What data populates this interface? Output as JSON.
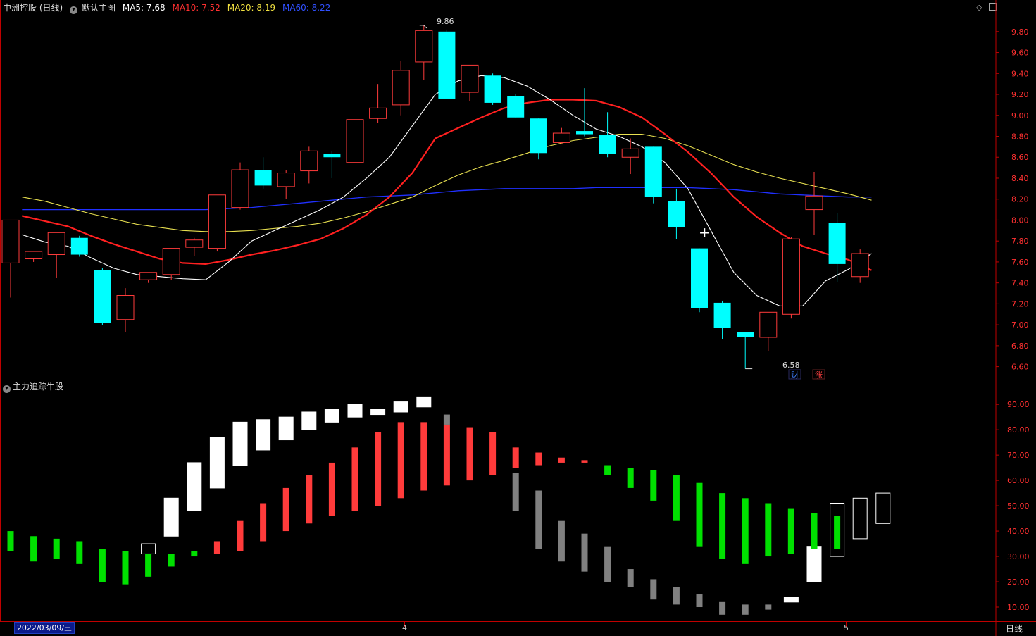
{
  "header": {
    "stock_label": "中洲控股 (日线)",
    "chart_label": "默认主图",
    "ma5": "MA5: 7.68",
    "ma10": "MA10: 7.52",
    "ma20": "MA20: 8.19",
    "ma60": "MA60: 8.22"
  },
  "sub_indicator": {
    "label": "主力追踪牛股"
  },
  "bottom_bar": {
    "date": "2022/03/09/三",
    "month_4": "4",
    "month_5": "5",
    "period": "日线"
  },
  "badges": {
    "cai": "财",
    "zhang": "涨"
  },
  "crosshair": "+",
  "colors": {
    "up": "#ff3b3b",
    "down": "#00ffff",
    "ma5": "#ffffff",
    "ma10": "#ff2020",
    "ma20": "#e8e050",
    "ma60": "#2030ff",
    "axis": "#c00000",
    "green": "#00e000",
    "gray": "#808080",
    "white": "#ffffff"
  },
  "chart_data": [
    {
      "type": "candlestick",
      "y_ticks": [
        "9.80",
        "9.60",
        "9.40",
        "9.20",
        "9.00",
        "8.80",
        "8.60",
        "8.40",
        "8.20",
        "8.00",
        "7.80",
        "7.60",
        "7.40",
        "7.20",
        "7.00",
        "6.80",
        "6.60"
      ],
      "ylim": [
        6.51,
        9.94
      ],
      "annotations": {
        "high": "9.86",
        "low": "6.58"
      },
      "candles": [
        {
          "o": 7.59,
          "h": 7.85,
          "l": 7.26,
          "c": 8.0
        },
        {
          "o": 7.63,
          "h": 7.7,
          "l": 7.6,
          "c": 7.7
        },
        {
          "o": 7.67,
          "h": 7.79,
          "l": 7.45,
          "c": 7.88
        },
        {
          "o": 7.83,
          "h": 7.85,
          "l": 7.65,
          "c": 7.67
        },
        {
          "o": 7.52,
          "h": 7.54,
          "l": 7.0,
          "c": 7.02
        },
        {
          "o": 7.05,
          "h": 7.35,
          "l": 6.93,
          "c": 7.28
        },
        {
          "o": 7.43,
          "h": 7.5,
          "l": 7.4,
          "c": 7.5
        },
        {
          "o": 7.48,
          "h": 7.71,
          "l": 7.43,
          "c": 7.73
        },
        {
          "o": 7.74,
          "h": 7.83,
          "l": 7.66,
          "c": 7.81
        },
        {
          "o": 7.73,
          "h": 8.23,
          "l": 7.7,
          "c": 8.24
        },
        {
          "o": 8.12,
          "h": 8.55,
          "l": 8.1,
          "c": 8.48
        },
        {
          "o": 8.48,
          "h": 8.6,
          "l": 8.3,
          "c": 8.33
        },
        {
          "o": 8.32,
          "h": 8.48,
          "l": 8.2,
          "c": 8.45
        },
        {
          "o": 8.47,
          "h": 8.7,
          "l": 8.35,
          "c": 8.66
        },
        {
          "o": 8.63,
          "h": 8.66,
          "l": 8.4,
          "c": 8.6
        },
        {
          "o": 8.55,
          "h": 8.96,
          "l": 8.55,
          "c": 8.96
        },
        {
          "o": 8.97,
          "h": 9.3,
          "l": 8.93,
          "c": 9.07
        },
        {
          "o": 9.1,
          "h": 9.52,
          "l": 9.0,
          "c": 9.43
        },
        {
          "o": 9.51,
          "h": 9.86,
          "l": 9.34,
          "c": 9.81
        },
        {
          "o": 9.8,
          "h": 9.82,
          "l": 9.16,
          "c": 9.16
        },
        {
          "o": 9.22,
          "h": 9.48,
          "l": 9.14,
          "c": 9.48
        },
        {
          "o": 9.38,
          "h": 9.4,
          "l": 9.1,
          "c": 9.12
        },
        {
          "o": 9.18,
          "h": 9.2,
          "l": 8.98,
          "c": 8.98
        },
        {
          "o": 8.97,
          "h": 8.97,
          "l": 8.58,
          "c": 8.64
        },
        {
          "o": 8.74,
          "h": 8.88,
          "l": 8.73,
          "c": 8.83
        },
        {
          "o": 8.85,
          "h": 9.26,
          "l": 8.8,
          "c": 8.82
        },
        {
          "o": 8.81,
          "h": 9.03,
          "l": 8.6,
          "c": 8.63
        },
        {
          "o": 8.6,
          "h": 8.78,
          "l": 8.44,
          "c": 8.68
        },
        {
          "o": 8.7,
          "h": 8.7,
          "l": 8.16,
          "c": 8.22
        },
        {
          "o": 8.18,
          "h": 8.3,
          "l": 7.82,
          "c": 7.93
        },
        {
          "o": 7.73,
          "h": 7.73,
          "l": 7.12,
          "c": 7.16
        },
        {
          "o": 7.21,
          "h": 7.23,
          "l": 6.86,
          "c": 6.97
        },
        {
          "o": 6.93,
          "h": 6.93,
          "l": 6.58,
          "c": 6.88
        },
        {
          "o": 6.88,
          "h": 7.12,
          "l": 6.75,
          "c": 7.12
        },
        {
          "o": 7.1,
          "h": 7.84,
          "l": 7.06,
          "c": 7.82
        },
        {
          "o": 8.1,
          "h": 8.46,
          "l": 7.86,
          "c": 8.23
        },
        {
          "o": 7.97,
          "h": 8.07,
          "l": 7.41,
          "c": 7.58
        },
        {
          "o": 7.46,
          "h": 7.72,
          "l": 7.4,
          "c": 7.68
        }
      ],
      "ma5": [
        8.03,
        7.86,
        7.79,
        7.75,
        7.64,
        7.54,
        7.48,
        7.46,
        7.44,
        7.43,
        7.6,
        7.8,
        7.9,
        8.0,
        8.1,
        8.22,
        8.4,
        8.6,
        8.9,
        9.2,
        9.33,
        9.38,
        9.36,
        9.28,
        9.15,
        9.0,
        8.87,
        8.8,
        8.7,
        8.55,
        8.3,
        7.9,
        7.5,
        7.28,
        7.18,
        7.18,
        7.42,
        7.53,
        7.68
      ],
      "ma10": [
        8.07,
        8.04,
        7.99,
        7.94,
        7.85,
        7.77,
        7.7,
        7.63,
        7.59,
        7.58,
        7.62,
        7.67,
        7.71,
        7.76,
        7.82,
        7.92,
        8.05,
        8.22,
        8.45,
        8.78,
        8.88,
        8.98,
        9.07,
        9.12,
        9.15,
        9.15,
        9.14,
        9.08,
        8.98,
        8.82,
        8.65,
        8.45,
        8.22,
        8.03,
        7.88,
        7.75,
        7.68,
        7.62,
        7.52
      ],
      "ma20": [
        8.25,
        8.22,
        8.18,
        8.12,
        8.06,
        8.01,
        7.96,
        7.93,
        7.9,
        7.89,
        7.89,
        7.9,
        7.92,
        7.94,
        7.97,
        8.02,
        8.08,
        8.15,
        8.22,
        8.33,
        8.43,
        8.51,
        8.57,
        8.64,
        8.71,
        8.76,
        8.79,
        8.82,
        8.82,
        8.78,
        8.71,
        8.62,
        8.53,
        8.46,
        8.4,
        8.35,
        8.3,
        8.25,
        8.19
      ],
      "ma60": [
        8.09,
        8.1,
        8.1,
        8.1,
        8.1,
        8.1,
        8.1,
        8.1,
        8.1,
        8.1,
        8.11,
        8.12,
        8.14,
        8.16,
        8.18,
        8.2,
        8.22,
        8.23,
        8.24,
        8.26,
        8.28,
        8.29,
        8.3,
        8.3,
        8.3,
        8.3,
        8.31,
        8.31,
        8.31,
        8.31,
        8.31,
        8.3,
        8.29,
        8.27,
        8.25,
        8.24,
        8.23,
        8.22,
        8.22
      ]
    },
    {
      "type": "bar",
      "title": "主力追踪牛股",
      "y_ticks": [
        "90.00",
        "80.00",
        "70.00",
        "60.00",
        "50.00",
        "40.00",
        "30.00",
        "20.00",
        "10.00"
      ],
      "ylim": [
        5.0,
        97.0
      ],
      "bars": [
        {
          "c": "green",
          "lo": 32,
          "hi": 40
        },
        {
          "c": "green",
          "lo": 28,
          "hi": 38
        },
        {
          "c": "green",
          "lo": 29,
          "hi": 37
        },
        {
          "c": "green",
          "lo": 27,
          "hi": 36
        },
        {
          "c": "green",
          "lo": 20,
          "hi": 33
        },
        {
          "c": "green",
          "lo": 19,
          "hi": 32
        },
        {
          "c": "green",
          "lo": 22,
          "hi": 31
        },
        {
          "c": "green",
          "lo": 26,
          "hi": 31
        },
        {
          "c": "green",
          "lo": 30,
          "hi": 32
        },
        {
          "c": "red",
          "lo": 31,
          "hi": 36
        },
        {
          "c": "red",
          "lo": 32,
          "hi": 44
        },
        {
          "c": "red",
          "lo": 36,
          "hi": 51
        },
        {
          "c": "red",
          "lo": 40,
          "hi": 57
        },
        {
          "c": "red",
          "lo": 43,
          "hi": 62
        },
        {
          "c": "red",
          "lo": 46,
          "hi": 67
        },
        {
          "c": "red",
          "lo": 48,
          "hi": 73
        },
        {
          "c": "red",
          "lo": 50,
          "hi": 79
        },
        {
          "c": "red",
          "lo": 53,
          "hi": 83
        },
        {
          "c": "red",
          "lo": 56,
          "hi": 83
        },
        {
          "c": "red",
          "lo": 58,
          "hi": 82
        },
        {
          "c": "red",
          "lo": 60,
          "hi": 81
        },
        {
          "c": "red",
          "lo": 62,
          "hi": 79
        },
        {
          "c": "red",
          "lo": 65,
          "hi": 73
        },
        {
          "c": "red",
          "lo": 66,
          "hi": 71
        },
        {
          "c": "red",
          "lo": 67,
          "hi": 69
        },
        {
          "c": "red",
          "lo": 67,
          "hi": 68
        },
        {
          "c": "green",
          "lo": 62,
          "hi": 66
        },
        {
          "c": "green",
          "lo": 57,
          "hi": 65
        },
        {
          "c": "green",
          "lo": 52,
          "hi": 64
        },
        {
          "c": "green",
          "lo": 44,
          "hi": 62
        },
        {
          "c": "green",
          "lo": 34,
          "hi": 59
        },
        {
          "c": "green",
          "lo": 29,
          "hi": 55
        },
        {
          "c": "green",
          "lo": 27,
          "hi": 53
        },
        {
          "c": "green",
          "lo": 30,
          "hi": 51
        },
        {
          "c": "green",
          "lo": 31,
          "hi": 49
        },
        {
          "c": "green",
          "lo": 33,
          "hi": 47
        },
        {
          "c": "green",
          "lo": 33,
          "hi": 46
        }
      ],
      "white_boxes": [
        {
          "i": 6,
          "lo": 31,
          "hi": 35
        },
        {
          "i": 7,
          "lo": 38,
          "hi": 53
        },
        {
          "i": 8,
          "lo": 48,
          "hi": 67
        },
        {
          "i": 9,
          "lo": 57,
          "hi": 77
        },
        {
          "i": 10,
          "lo": 66,
          "hi": 83
        },
        {
          "i": 11,
          "lo": 72,
          "hi": 84
        },
        {
          "i": 12,
          "lo": 76,
          "hi": 85
        },
        {
          "i": 13,
          "lo": 80,
          "hi": 87
        },
        {
          "i": 14,
          "lo": 83,
          "hi": 88
        },
        {
          "i": 15,
          "lo": 85,
          "hi": 90
        },
        {
          "i": 16,
          "lo": 86,
          "hi": 88
        },
        {
          "i": 17,
          "lo": 87,
          "hi": 91
        },
        {
          "i": 18,
          "lo": 89,
          "hi": 93
        },
        {
          "i": 34,
          "lo": 12,
          "hi": 14
        },
        {
          "i": 35,
          "lo": 20,
          "hi": 34
        },
        {
          "i": 36,
          "lo": 30,
          "hi": 51
        },
        {
          "i": 37,
          "lo": 37,
          "hi": 53
        },
        {
          "i": 38,
          "lo": 43,
          "hi": 55
        }
      ],
      "gray_bars": [
        {
          "i": 19,
          "lo": 82,
          "hi": 86
        },
        {
          "i": 22,
          "lo": 48,
          "hi": 63
        },
        {
          "i": 23,
          "lo": 33,
          "hi": 56
        },
        {
          "i": 24,
          "lo": 28,
          "hi": 44
        },
        {
          "i": 25,
          "lo": 24,
          "hi": 39
        },
        {
          "i": 26,
          "lo": 20,
          "hi": 34
        },
        {
          "i": 27,
          "lo": 18,
          "hi": 25
        },
        {
          "i": 28,
          "lo": 13,
          "hi": 21
        },
        {
          "i": 29,
          "lo": 11,
          "hi": 18
        },
        {
          "i": 30,
          "lo": 10,
          "hi": 15
        },
        {
          "i": 31,
          "lo": 7,
          "hi": 12
        },
        {
          "i": 32,
          "lo": 7,
          "hi": 11
        },
        {
          "i": 33,
          "lo": 9,
          "hi": 11
        }
      ]
    }
  ]
}
